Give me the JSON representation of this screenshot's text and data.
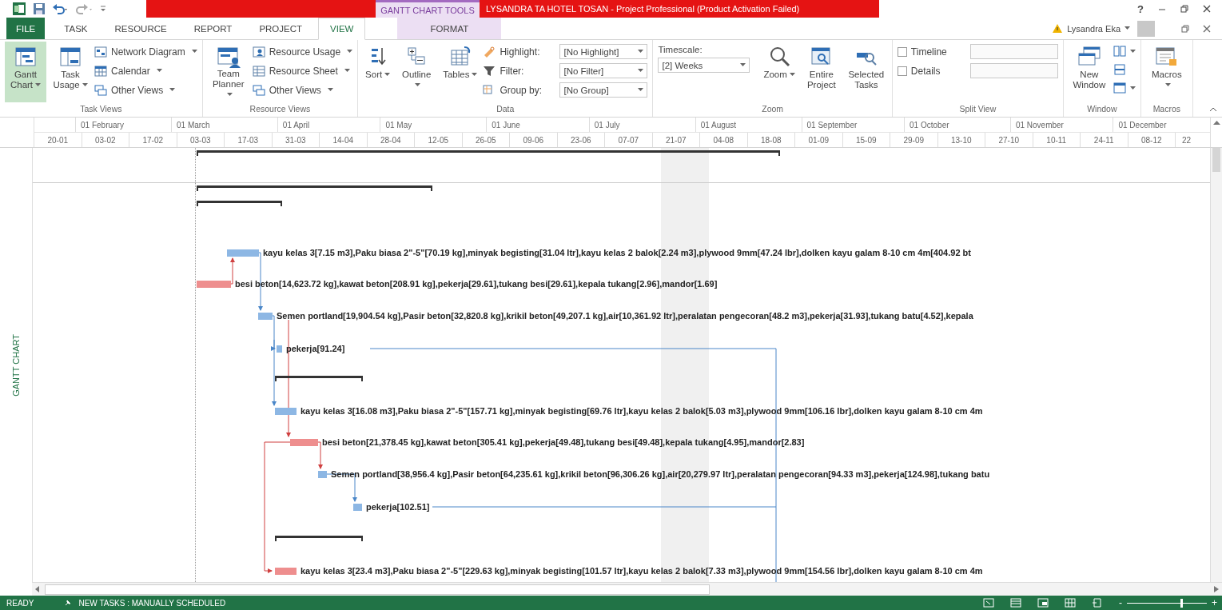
{
  "title_bar": {
    "context_tab": "GANTT CHART TOOLS",
    "title": "LYSANDRA TA HOTEL TOSAN -  Project Professional (Product Activation Failed)",
    "help": "?"
  },
  "tabs": [
    {
      "label": "FILE",
      "kind": "file",
      "selected": false
    },
    {
      "label": "TASK",
      "kind": "normal",
      "selected": false
    },
    {
      "label": "RESOURCE",
      "kind": "normal",
      "selected": false
    },
    {
      "label": "REPORT",
      "kind": "normal",
      "selected": false
    },
    {
      "label": "PROJECT",
      "kind": "normal",
      "selected": false
    },
    {
      "label": "VIEW",
      "kind": "normal",
      "selected": true
    },
    {
      "label": "FORMAT",
      "kind": "context",
      "selected": false
    }
  ],
  "user": {
    "name": "Lysandra Eka"
  },
  "ribbon": [
    {
      "label": "Task Views",
      "items": [
        {
          "kind": "large",
          "label": "Gantt Chart",
          "selected": true,
          "dropdown": true
        },
        {
          "kind": "large",
          "label": "Task Usage",
          "selected": false,
          "dropdown": true
        },
        {
          "kind": "column",
          "rows": [
            {
              "kind": "small",
              "label": "Network Diagram",
              "dropdown": true
            },
            {
              "kind": "small",
              "label": "Calendar",
              "dropdown": true
            },
            {
              "kind": "small",
              "label": "Other Views",
              "dropdown": true
            }
          ]
        }
      ]
    },
    {
      "label": "Resource Views",
      "items": [
        {
          "kind": "large",
          "label": "Team Planner",
          "selected": false,
          "dropdown": true
        },
        {
          "kind": "column",
          "rows": [
            {
              "kind": "small",
              "label": "Resource Usage",
              "dropdown": true
            },
            {
              "kind": "small",
              "label": "Resource Sheet",
              "dropdown": true
            },
            {
              "kind": "small",
              "label": "Other Views",
              "dropdown": true
            }
          ]
        }
      ]
    },
    {
      "label": "Data",
      "items": [
        {
          "kind": "large",
          "label": "Sort",
          "selected": false,
          "dropdown": true
        },
        {
          "kind": "large",
          "label": "Outline",
          "selected": false,
          "dropdown": true
        },
        {
          "kind": "large",
          "label": "Tables",
          "selected": false,
          "dropdown": true
        },
        {
          "kind": "column",
          "rows": [
            {
              "kind": "combo",
              "label": "Highlight:",
              "value": "[No Highlight]"
            },
            {
              "kind": "combo",
              "label": "Filter:",
              "value": "[No Filter]"
            },
            {
              "kind": "combo",
              "label": "Group by:",
              "value": "[No Group]"
            }
          ]
        }
      ]
    },
    {
      "label": "Zoom",
      "items": [
        {
          "kind": "stacked_combo",
          "label": "Timescale:",
          "value": "[2] Weeks"
        },
        {
          "kind": "large",
          "label": "Zoom",
          "selected": false,
          "dropdown": true
        },
        {
          "kind": "large",
          "label": "Entire Project",
          "selected": false,
          "dropdown": false
        },
        {
          "kind": "large",
          "label": "Selected Tasks",
          "selected": false,
          "dropdown": false
        }
      ]
    },
    {
      "label": "Split View",
      "items": [
        {
          "kind": "column",
          "rows": [
            {
              "kind": "checkbox",
              "label": "Timeline",
              "checked": false
            },
            {
              "kind": "checkbox",
              "label": "Details",
              "checked": false
            }
          ]
        }
      ]
    },
    {
      "label": "Window",
      "items": [
        {
          "kind": "large",
          "label": "New Window",
          "selected": false,
          "dropdown": false
        },
        {
          "kind": "column",
          "rows": [
            {
              "kind": "icon",
              "dropdown": true
            },
            {
              "kind": "icon",
              "dropdown": false
            },
            {
              "kind": "icon",
              "dropdown": true
            }
          ]
        }
      ]
    },
    {
      "label": "Macros",
      "items": [
        {
          "kind": "large",
          "label": "Macros",
          "selected": false,
          "dropdown": true
        }
      ]
    }
  ],
  "timescale": {
    "months": [
      "01 February",
      "01 March",
      "01 April",
      "01 May",
      "01 June",
      "01 July",
      "01 August",
      "01 September",
      "01 October",
      "01 November",
      "01 December"
    ],
    "weeks": [
      "20-01",
      "03-02",
      "17-02",
      "03-03",
      "17-03",
      "31-03",
      "14-04",
      "28-04",
      "12-05",
      "26-05",
      "09-06",
      "23-06",
      "07-07",
      "21-07",
      "04-08",
      "18-08",
      "01-09",
      "15-09",
      "29-09",
      "13-10",
      "27-10",
      "10-11",
      "24-11",
      "08-12",
      "22"
    ]
  },
  "view_label": "GANTT CHART",
  "tasks": [
    {
      "kind": "summary"
    },
    {
      "kind": "summary"
    },
    {
      "kind": "summary"
    },
    {
      "kind": "task",
      "critical": false,
      "label": "kayu kelas 3[7.15 m3],Paku biasa 2\"-5\"[70.19 kg],minyak begisting[31.04 ltr],kayu kelas 2 balok[2.24 m3],plywood 9mm[47.24 lbr],dolken kayu galam 8-10 cm 4m[404.92 bt"
    },
    {
      "kind": "task",
      "critical": true,
      "label": "besi beton[14,623.72 kg],kawat beton[208.91 kg],pekerja[29.61],tukang besi[29.61],kepala tukang[2.96],mandor[1.69]"
    },
    {
      "kind": "task",
      "critical": false,
      "label": "Semen portland[19,904.54 kg],Pasir beton[32,820.8 kg],krikil beton[49,207.1 kg],air[10,361.92 ltr],peralatan pengecoran[48.2 m3],pekerja[31.93],tukang batu[4.52],kepala"
    },
    {
      "kind": "task",
      "critical": false,
      "label": "pekerja[91.24]"
    },
    {
      "kind": "summary"
    },
    {
      "kind": "task",
      "critical": false,
      "label": "kayu kelas 3[16.08 m3],Paku biasa 2\"-5\"[157.71 kg],minyak begisting[69.76 ltr],kayu kelas 2 balok[5.03 m3],plywood 9mm[106.16 lbr],dolken kayu galam 8-10 cm 4m"
    },
    {
      "kind": "task",
      "critical": true,
      "label": "besi beton[21,378.45 kg],kawat beton[305.41 kg],pekerja[49.48],tukang besi[49.48],kepala tukang[4.95],mandor[2.83]"
    },
    {
      "kind": "task",
      "critical": false,
      "label": "Semen portland[38,956.4 kg],Pasir beton[64,235.61 kg],krikil beton[96,306.26 kg],air[20,279.97 ltr],peralatan pengecoran[94.33 m3],pekerja[124.98],tukang batu"
    },
    {
      "kind": "task",
      "critical": false,
      "label": "pekerja[102.51]"
    },
    {
      "kind": "summary"
    },
    {
      "kind": "task",
      "critical": true,
      "label": "kayu kelas 3[23.4 m3],Paku biasa 2\"-5\"[229.63 kg],minyak begisting[101.57 ltr],kayu kelas 2 balok[7.33 m3],plywood 9mm[154.56 lbr],dolken kayu galam 8-10 cm 4m"
    }
  ],
  "status_bar": {
    "state": "READY",
    "mode": "NEW TASKS : MANUALLY SCHEDULED",
    "zoom": {
      "minus": "-",
      "plus": "+",
      "level": 0.67
    }
  }
}
